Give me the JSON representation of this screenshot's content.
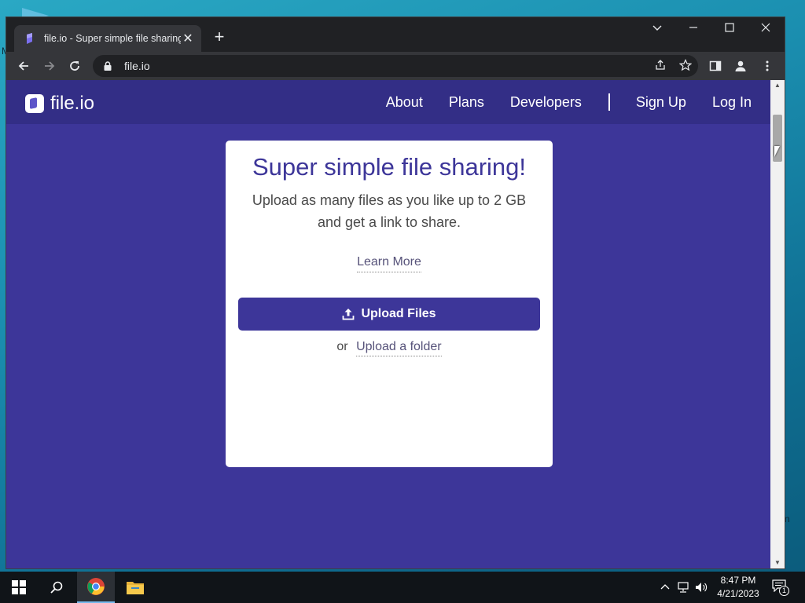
{
  "browser": {
    "tab_title": "file.io - Super simple file sharing",
    "url": "file.io",
    "tab_close": "✕",
    "new_tab": "+"
  },
  "site": {
    "logo_text": "file.io",
    "nav": {
      "about": "About",
      "plans": "Plans",
      "developers": "Developers",
      "sign_up": "Sign Up",
      "log_in": "Log In"
    }
  },
  "card": {
    "title": "Super simple file sharing!",
    "description": "Upload as many files as you like up to 2 GB and get a link to share.",
    "learn_more": "Learn More",
    "upload_files": "Upload Files",
    "or_text": "or",
    "upload_folder": "Upload a folder"
  },
  "taskbar": {
    "time": "8:47 PM",
    "date": "4/21/2023",
    "notification_count": "1"
  },
  "desktop": {
    "edge_letter_left": "M",
    "edge_letter_right": "n"
  },
  "colors": {
    "brand": "#3d3699",
    "nav_bg": "#332e86",
    "browser_dark": "#202124",
    "toolbar": "#35363a"
  },
  "icons": [
    "back-arrow-icon",
    "forward-arrow-icon",
    "reload-icon",
    "lock-icon",
    "share-icon",
    "star-icon",
    "side-panel-icon",
    "profile-icon",
    "more-menu-icon",
    "upload-icon",
    "windows-logo-icon",
    "search-icon",
    "chrome-icon",
    "file-explorer-icon",
    "network-icon",
    "volume-icon",
    "notification-icon"
  ]
}
